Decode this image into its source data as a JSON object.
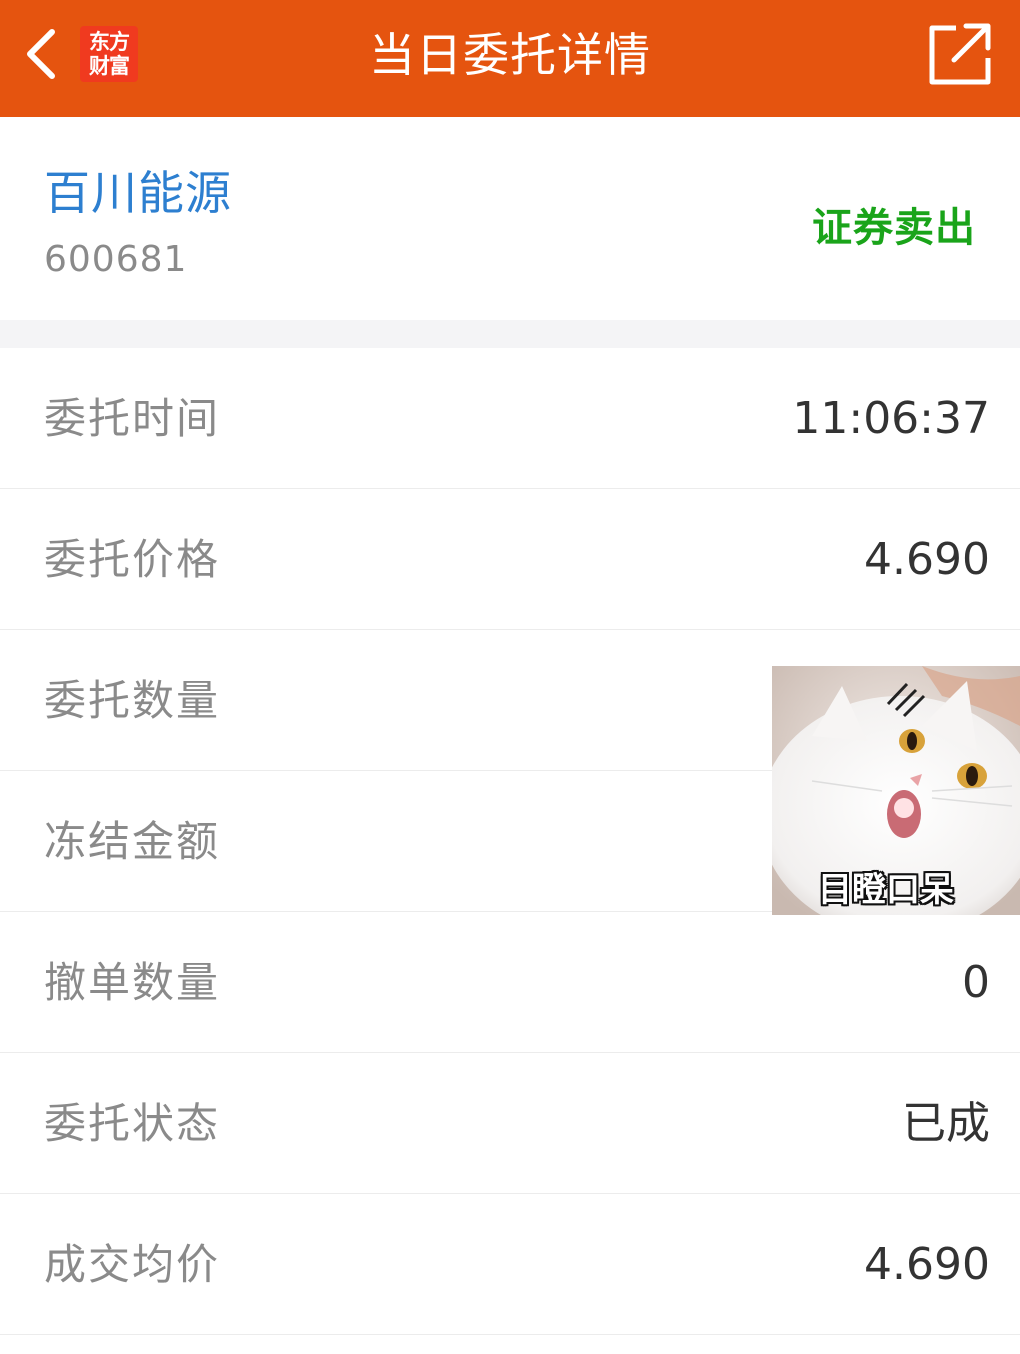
{
  "header": {
    "title": "当日委托详情",
    "logo_line1": "东方",
    "logo_line2": "财富",
    "back_icon": "chevron-left-icon",
    "share_icon": "share-external-icon",
    "color": "#e5540f"
  },
  "stock": {
    "name": "百川能源",
    "code": "600681",
    "side": "证券卖出",
    "name_color": "#2d7fd0",
    "side_color": "#1aa41a"
  },
  "details": [
    {
      "label": "委托时间",
      "value": "11:06:37"
    },
    {
      "label": "委托价格",
      "value": "4.690"
    },
    {
      "label": "委托数量",
      "value": ""
    },
    {
      "label": "冻结金额",
      "value": ""
    },
    {
      "label": "撤单数量",
      "value": "0"
    },
    {
      "label": "委托状态",
      "value": "已成"
    },
    {
      "label": "成交均价",
      "value": "4.690"
    }
  ],
  "sticker": {
    "caption": "目瞪口呆",
    "subject": "white-cat-image"
  }
}
